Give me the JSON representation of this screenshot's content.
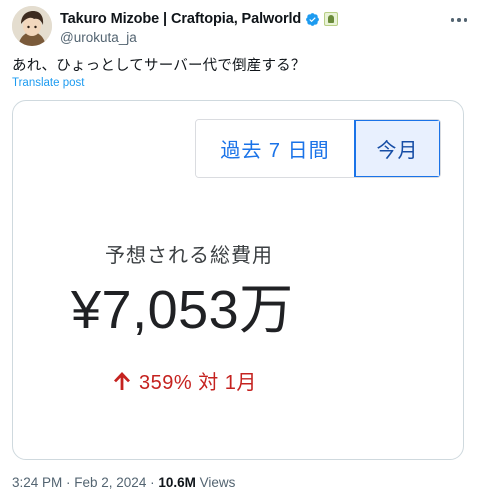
{
  "author": {
    "display_name": "Takuro Mizobe | Craftopia, Palworld",
    "handle": "@urokuta_ja"
  },
  "tweet": {
    "text": "あれ、ひょっとしてサーバー代で倒産する？",
    "translate_label": "Translate post"
  },
  "card": {
    "tabs": [
      {
        "label": "過去 7 日間",
        "selected": false
      },
      {
        "label": "今月",
        "selected": true
      }
    ],
    "cost_label": "予想される総費用",
    "cost_value": "¥7,053万",
    "change_text": "359% 対 1月"
  },
  "meta": {
    "timestamp": "3:24 PM · Feb 2, 2024 · ",
    "views_count": "10.6M",
    "views_label": " Views"
  },
  "colors": {
    "link": "#1d9bf0",
    "verified": "#1d9bf0",
    "tab_accent": "#1a73e8",
    "tab_selected_bg": "#e8f0fe",
    "increase": "#c5221f"
  },
  "icons": [
    "verified-badge-icon",
    "affiliate-badge-icon",
    "more-options-icon",
    "arrow-up-icon"
  ]
}
